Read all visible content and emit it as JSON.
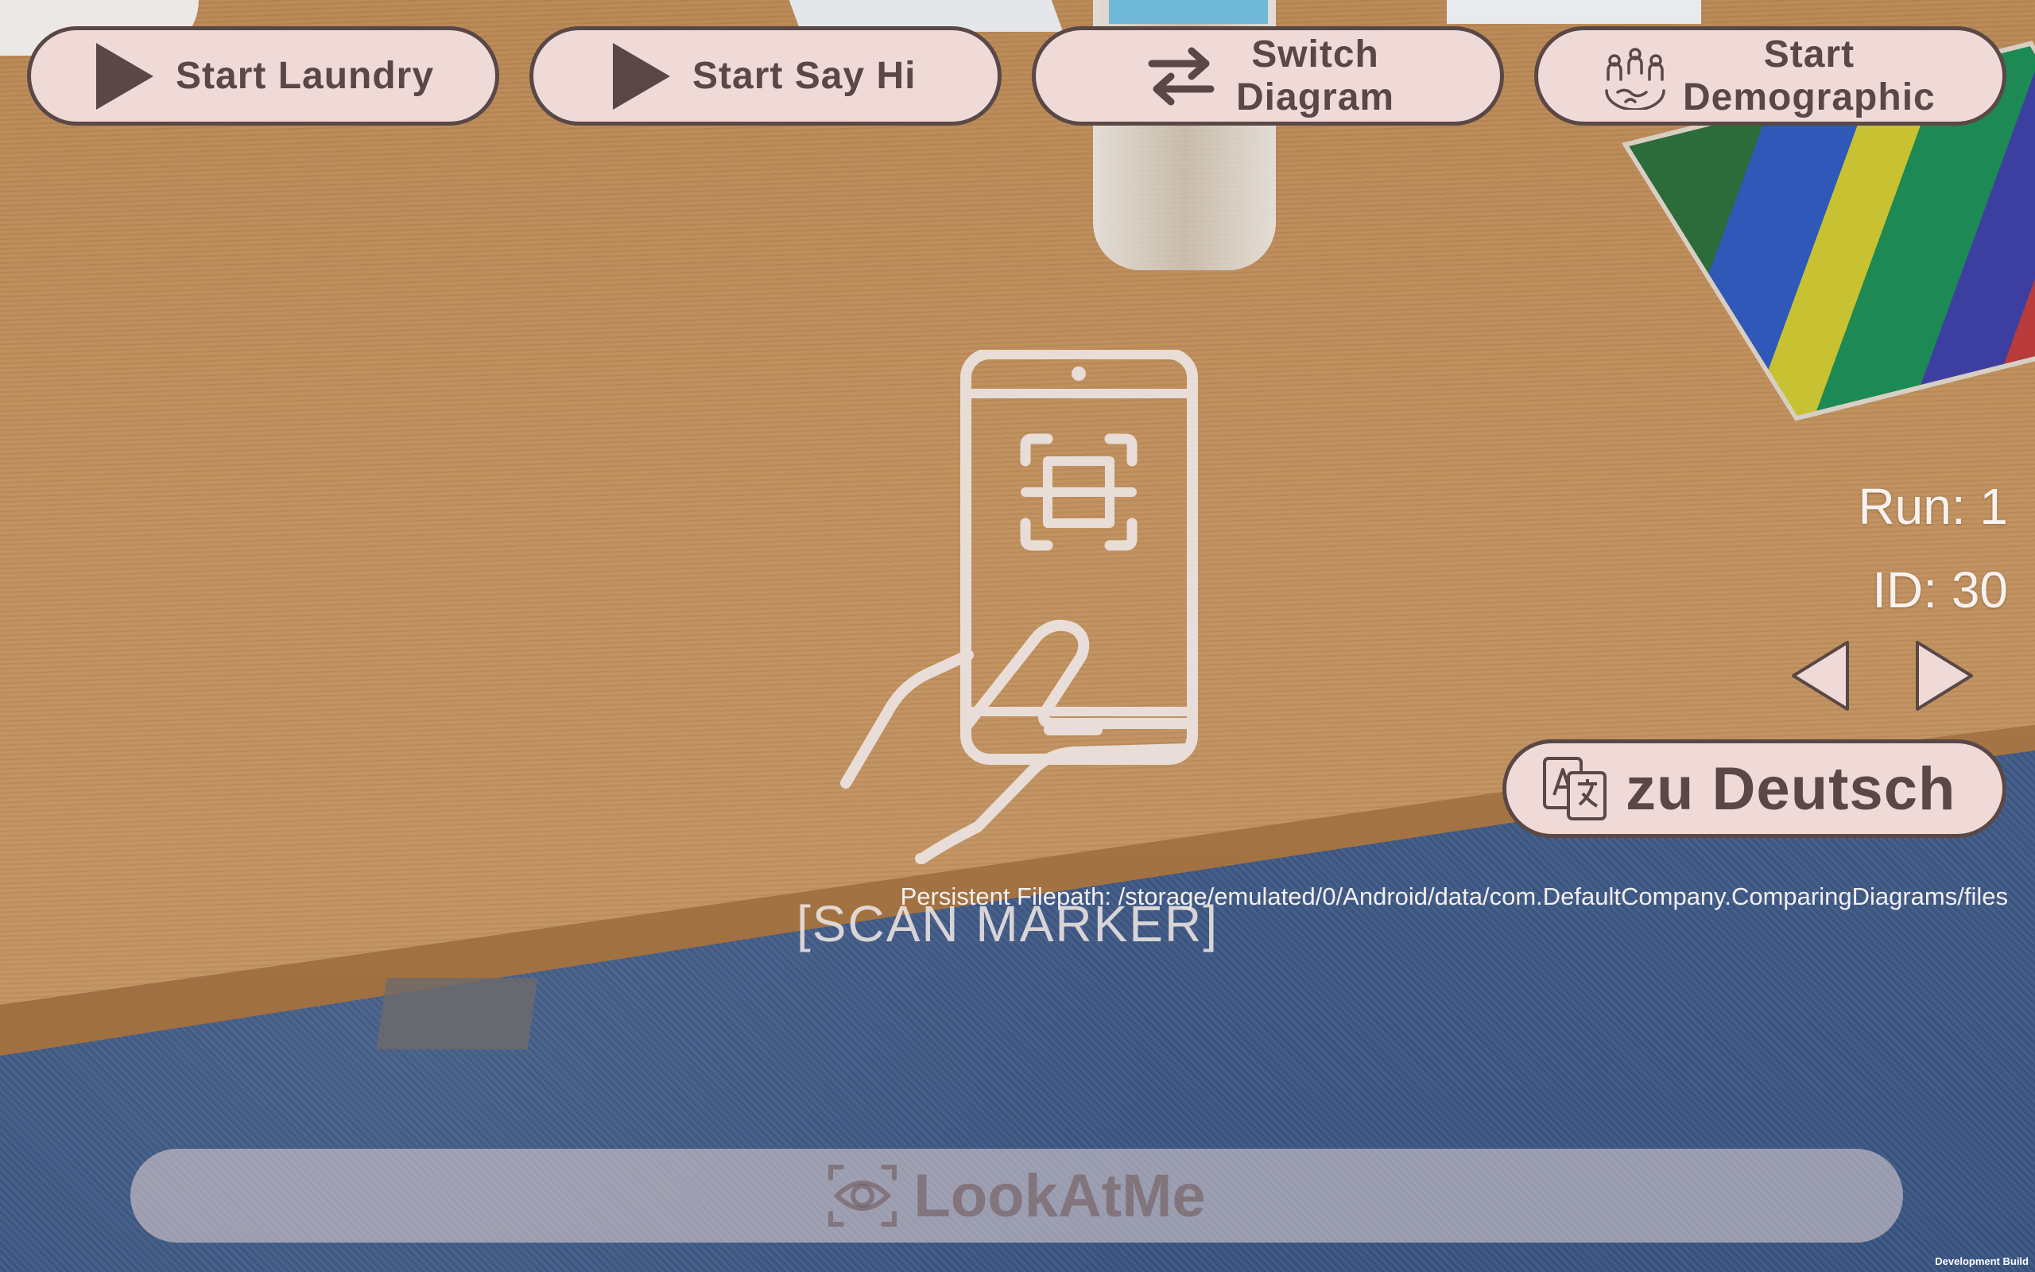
{
  "top_buttons": {
    "start_laundry": "Start Laundry",
    "start_say_hi": "Start Say Hi",
    "switch_diagram_line1": "Switch",
    "switch_diagram_line2": "Diagram",
    "start_demographic_line1": "Start",
    "start_demographic_line2": "Demographic"
  },
  "status": {
    "run": "Run: 1",
    "id": "ID: 30"
  },
  "language_button": "zu Deutsch",
  "filepath": "Persistent Filepath: /storage/emulated/0/Android/data/com.DefaultCompany.ComparingDiagrams/files",
  "scan_prompt": "[SCAN MARKER]",
  "look_at_me": "LookAtMe",
  "dev_build": "Development Build",
  "icons": [
    "play-icon",
    "switch-arrows-icon",
    "people-globe-icon",
    "arrow-left-icon",
    "arrow-right-icon",
    "translate-icon",
    "eye-scan-icon",
    "phone-scan-icon"
  ],
  "colors": {
    "button_fill": "#f0dad7",
    "button_border": "#5a4846",
    "overlay_text": "#f7f2f0"
  }
}
